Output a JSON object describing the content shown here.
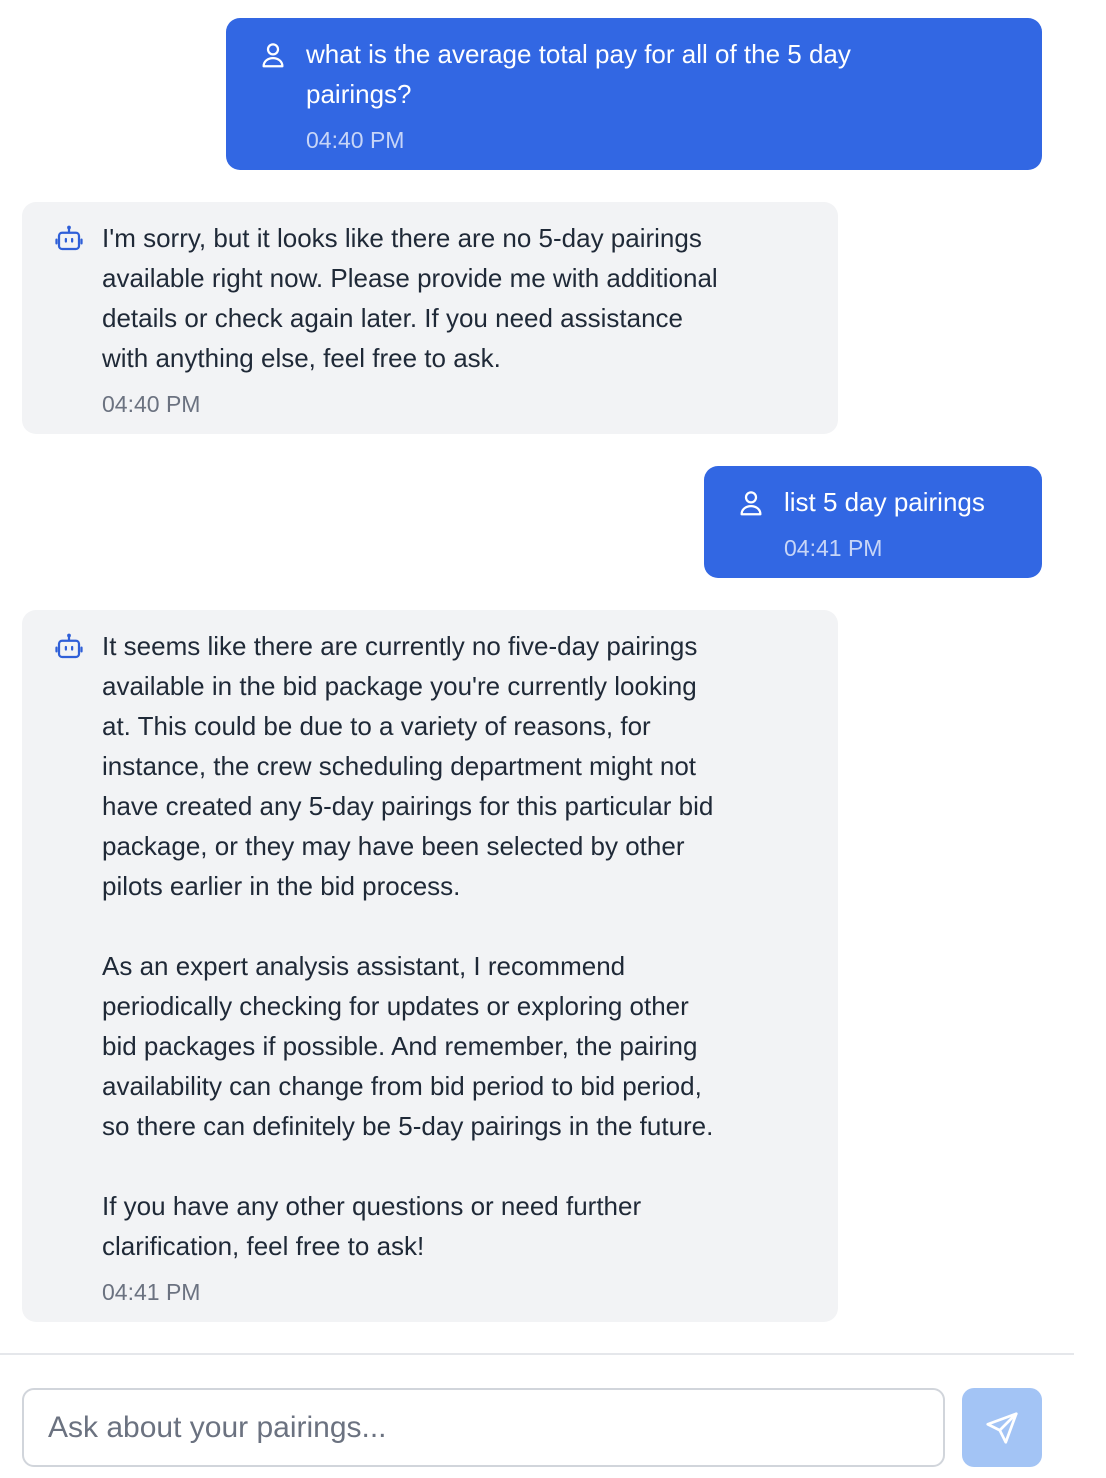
{
  "messages": [
    {
      "role": "user",
      "icon": "user-icon",
      "text": "what is the average total pay for all of the 5 day\npairings?",
      "time": "04:40 PM"
    },
    {
      "role": "bot",
      "icon": "bot-icon",
      "text": "I'm sorry, but it looks like there are no 5-day pairings\navailable right now. Please provide me with additional\ndetails or check again later. If you need assistance\nwith anything else, feel free to ask.",
      "time": "04:40 PM"
    },
    {
      "role": "user",
      "icon": "user-icon",
      "text": "list 5 day pairings",
      "time": "04:41 PM"
    },
    {
      "role": "bot",
      "icon": "bot-icon",
      "text": "It seems like there are currently no five-day pairings\navailable in the bid package you're currently looking\nat. This could be due to a variety of reasons, for\ninstance, the crew scheduling department might not\nhave created any 5-day pairings for this particular bid\npackage, or they may have been selected by other\npilots earlier in the bid process.\n\nAs an expert analysis assistant, I recommend\nperiodically checking for updates or exploring other\nbid packages if possible. And remember, the pairing\navailability can change from bid period to bid period,\nso there can definitely be 5-day pairings in the future.\n\nIf you have any other questions or need further\nclarification, feel free to ask!",
      "time": "04:41 PM"
    }
  ],
  "composer": {
    "placeholder": "Ask about your pairings...",
    "value": "",
    "send_icon": "send-icon"
  },
  "colors": {
    "user_bubble": "#3267e3",
    "bot_bubble": "#f2f3f5",
    "bot_icon": "#2f5fd8",
    "send_button": "#a3c4f5"
  }
}
